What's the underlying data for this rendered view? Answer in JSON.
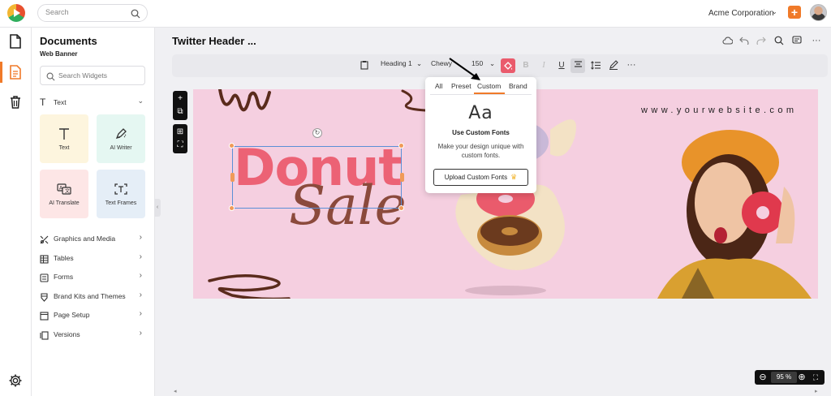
{
  "topbar": {
    "search_placeholder": "Search",
    "company": "Acme Corporation"
  },
  "panel": {
    "title": "Documents",
    "subtitle": "Web Banner",
    "widget_search_placeholder": "Search Widgets",
    "text_section": "Text",
    "cards": [
      {
        "label": "Text",
        "icon": "text-t-icon",
        "bg": "#fdf5de"
      },
      {
        "label": "AI Writer",
        "icon": "ai-writer-icon",
        "bg": "#e5f7f2"
      },
      {
        "label": "AI Translate",
        "icon": "ai-translate-icon",
        "bg": "#fde6e6"
      },
      {
        "label": "Text Frames",
        "icon": "text-frames-icon",
        "bg": "#e5eef7"
      }
    ],
    "menu": [
      {
        "label": "Graphics and Media",
        "icon": "graphics-icon"
      },
      {
        "label": "Tables",
        "icon": "table-icon"
      },
      {
        "label": "Forms",
        "icon": "forms-icon"
      },
      {
        "label": "Brand Kits and Themes",
        "icon": "brand-kit-icon"
      },
      {
        "label": "Page Setup",
        "icon": "page-setup-icon"
      },
      {
        "label": "Versions",
        "icon": "versions-icon"
      }
    ]
  },
  "editor": {
    "doc_title": "Twitter Header ...",
    "toolbar": {
      "style": "Heading 1",
      "font": "Chewy",
      "size": "150"
    }
  },
  "canvas": {
    "website": "www.yourwebsite.com",
    "headline_1": "Donut",
    "headline_2": "Sale",
    "colors": {
      "background": "#f5cfe0",
      "donut_text": "#ec6275",
      "sale_text": "#8b4a3c"
    }
  },
  "popover": {
    "tabs": [
      "All",
      "Preset",
      "Custom",
      "Brand"
    ],
    "active_tab": "Custom",
    "glyph": "Aa",
    "heading": "Use Custom Fonts",
    "description": "Make your design unique with custom fonts.",
    "button": "Upload Custom Fonts"
  },
  "zoom": {
    "value": "95 %"
  },
  "accent": "#f07a29"
}
